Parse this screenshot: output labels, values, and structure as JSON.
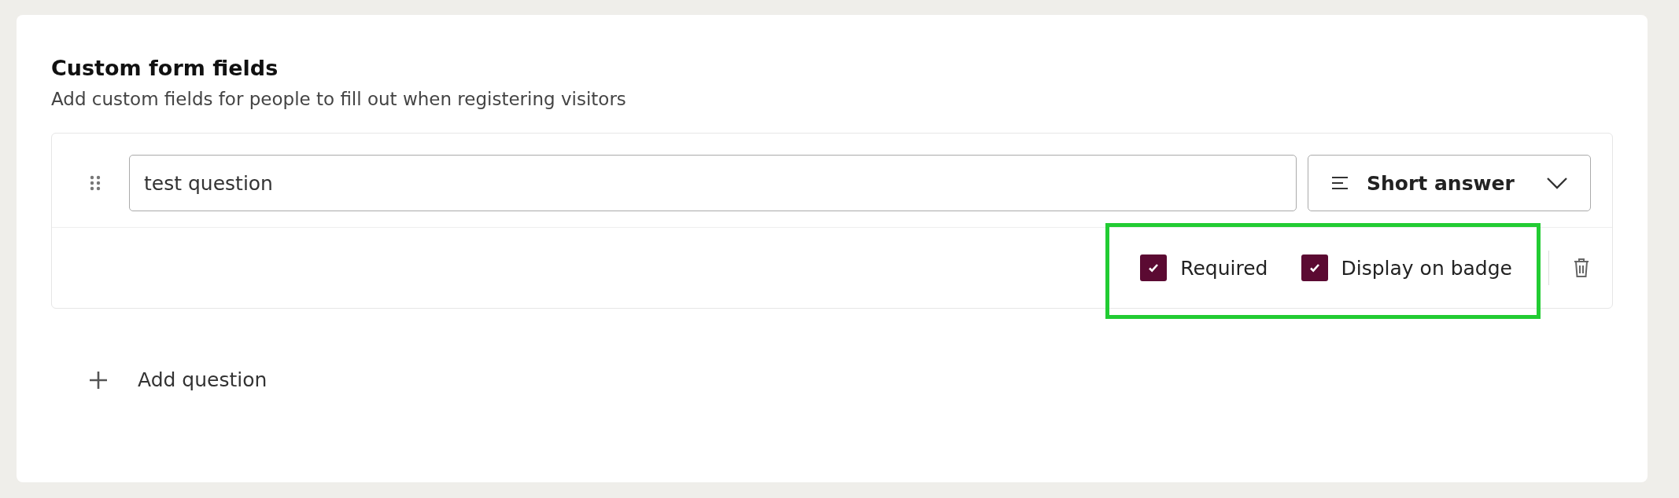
{
  "section": {
    "title": "Custom form fields",
    "description": "Add custom fields for people to fill out when registering visitors"
  },
  "questions": [
    {
      "value": "test question",
      "type": {
        "label": "Short answer"
      },
      "options": [
        {
          "label": "Required",
          "checked": true
        },
        {
          "label": "Display on badge",
          "checked": true
        }
      ],
      "highlighted": true
    }
  ],
  "add_button": {
    "label": "Add question"
  }
}
